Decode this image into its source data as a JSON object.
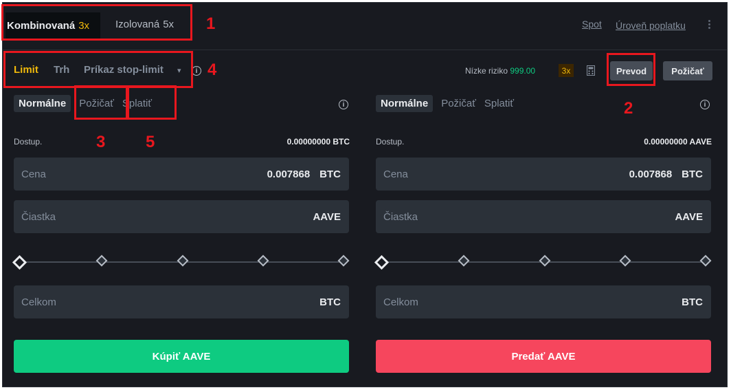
{
  "header": {
    "tab_cross": {
      "label": "Kombinovaná",
      "mult": "3x"
    },
    "tab_isolated": {
      "label": "Izolovaná",
      "mult": "5x"
    },
    "spot_link": "Spot",
    "fee_link": "Úroveň poplatku"
  },
  "order_types": {
    "limit": "Limit",
    "market": "Trh",
    "stop_limit": "Príkaz stop-limit",
    "dropdown_arrow": "▾"
  },
  "risk": {
    "label": "Nízke riziko",
    "value": "999.00",
    "leverage": "3x"
  },
  "buttons": {
    "transfer": "Prevod",
    "borrow": "Požičať"
  },
  "buy": {
    "tabs": [
      "Normálne",
      "Požičať",
      "Splatiť"
    ],
    "available_label": "Dostup.",
    "available_value": "0.00000000 BTC",
    "price_label": "Cena",
    "price_value": "0.007868",
    "price_unit": "BTC",
    "amount_label": "Čiastka",
    "amount_unit": "AAVE",
    "total_label": "Celkom",
    "total_unit": "BTC",
    "action": "Kúpiť AAVE",
    "action_color": "#0ecb81"
  },
  "sell": {
    "tabs": [
      "Normálne",
      "Požičať",
      "Splatiť"
    ],
    "available_label": "Dostup.",
    "available_value": "0.00000000 AAVE",
    "price_label": "Cena",
    "price_value": "0.007868",
    "price_unit": "BTC",
    "amount_label": "Čiastka",
    "amount_unit": "AAVE",
    "total_label": "Celkom",
    "total_unit": "BTC",
    "action": "Predať AAVE",
    "action_color": "#f6465d"
  },
  "annotations": [
    "1",
    "2",
    "3",
    "4",
    "5"
  ],
  "colors": {
    "accent": "#f0b90b",
    "annotation": "#e8171e",
    "background": "#181a20"
  }
}
